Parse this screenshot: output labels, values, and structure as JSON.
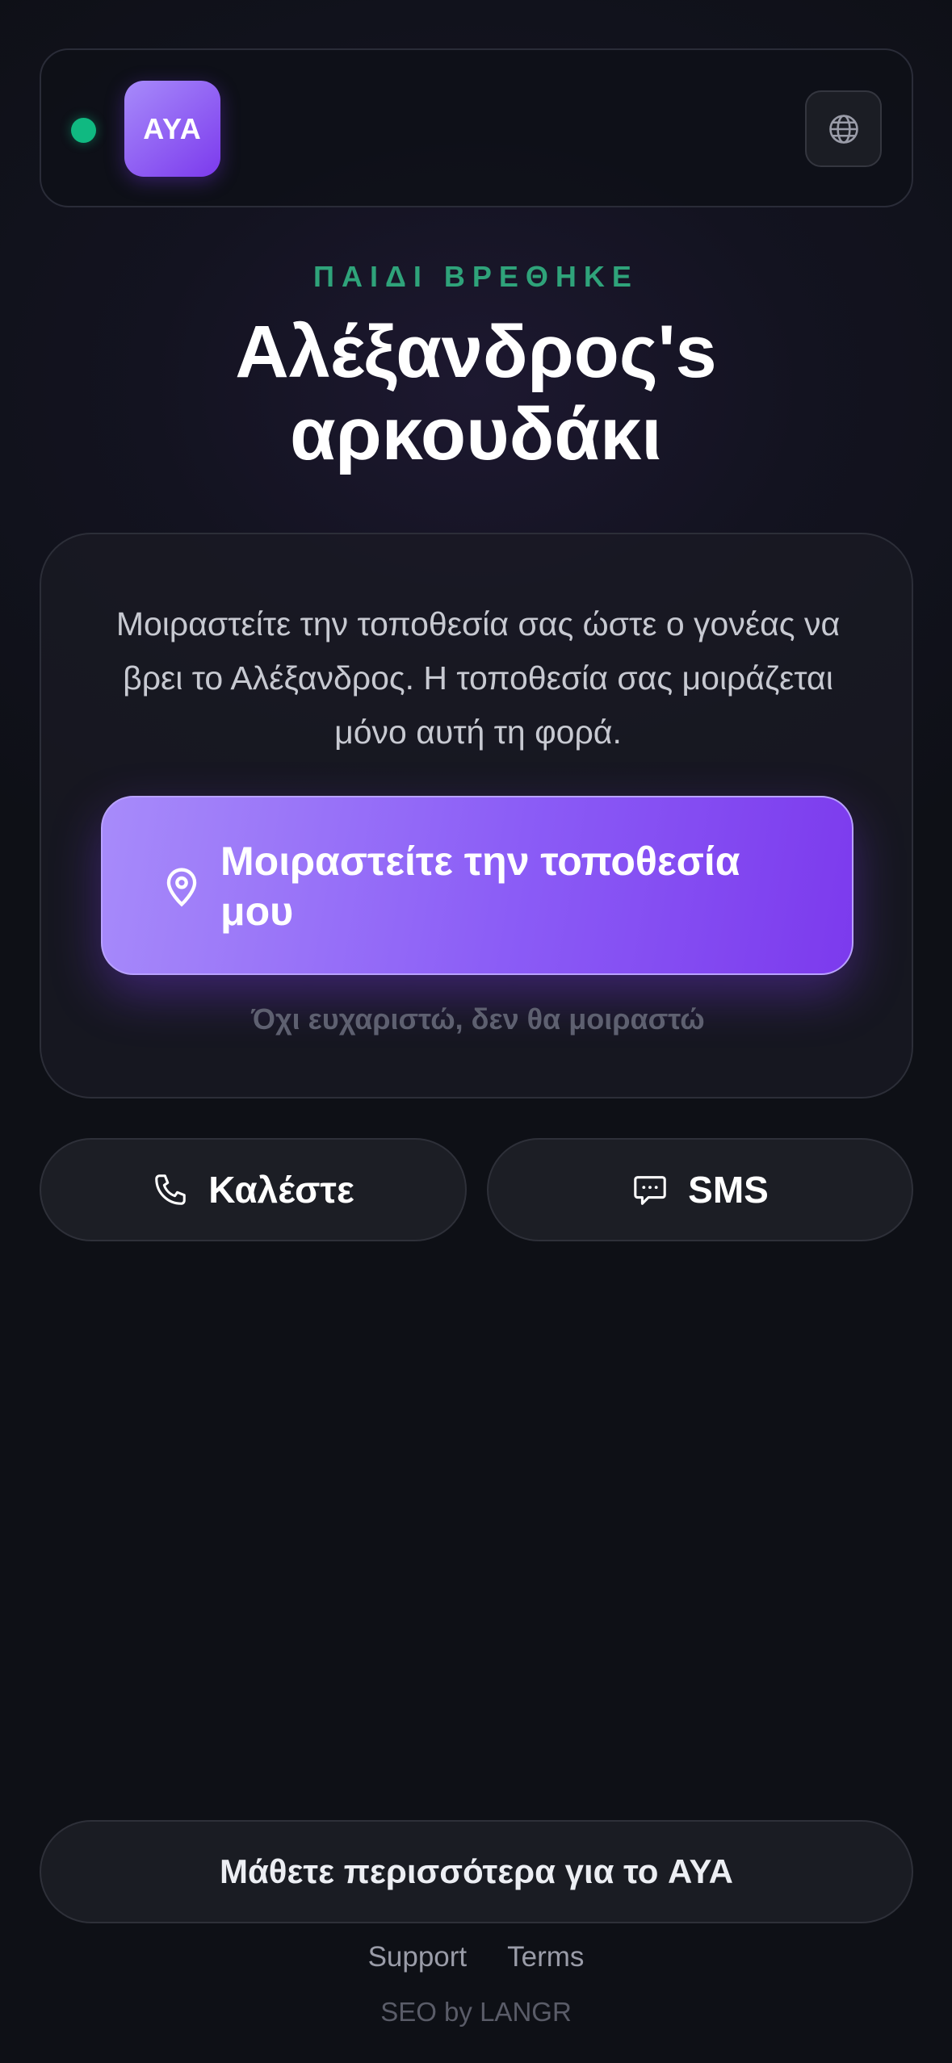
{
  "header": {
    "status": "online",
    "logo_text": "AYA",
    "language_icon": "globe-icon"
  },
  "hero": {
    "eyebrow": "ΠΑΙΔΙ ΒΡΕΘΗΚΕ",
    "title_line1": "Αλέξανδρος's",
    "title_line2": "αρκουδάκι"
  },
  "card": {
    "description": "Μοιραστείτε την τοποθεσία σας ώστε ο γονέας να βρει το Αλέξανδρος. Η τοποθεσία σας μοιράζεται μόνο αυτή τη φορά.",
    "share_label": "Μοιραστείτε την τοποθεσία μου",
    "share_icon": "location-pin-icon",
    "decline_label": "Όχι ευχαριστώ, δεν θα μοιραστώ"
  },
  "actions": {
    "call_label": "Καλέστε",
    "call_icon": "phone-icon",
    "sms_label": "SMS",
    "sms_icon": "message-icon"
  },
  "footer": {
    "learn_more": "Μάθετε περισσότερα για το AYA",
    "links": [
      "Support",
      "Terms"
    ],
    "credit": "SEO by LANGR"
  },
  "colors": {
    "accent": "#8b5cf6",
    "status": "#10b981",
    "eyebrow": "#2fa37a"
  }
}
